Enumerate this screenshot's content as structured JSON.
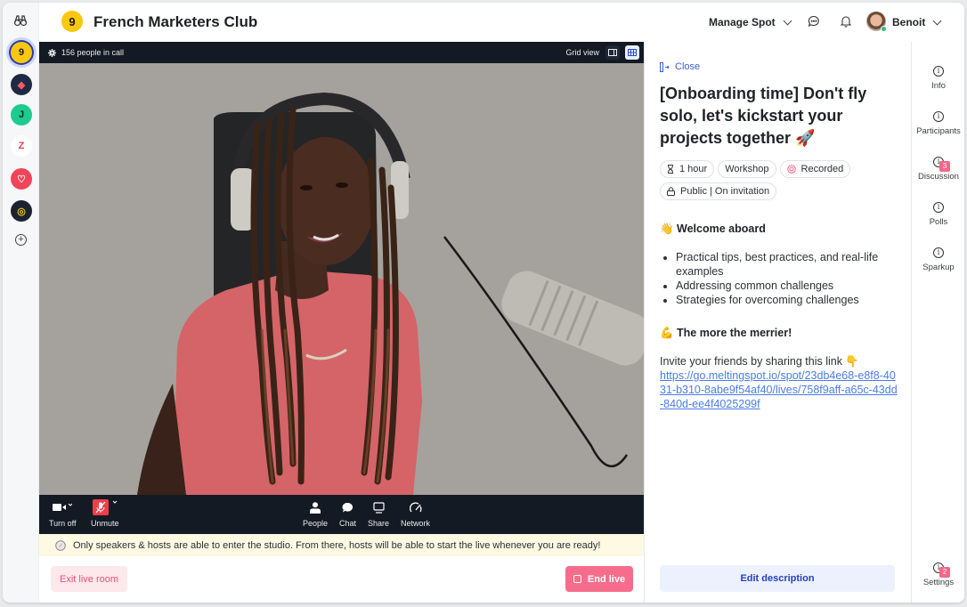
{
  "app": {
    "club_name": "French Marketers Club",
    "logo_glyph": "9"
  },
  "rail": {
    "top_icon": "binoculars-icon",
    "spots": [
      {
        "name": "french-marketers-club",
        "glyph": "9",
        "bg": "#f9c80e",
        "fg": "#1a1a1a",
        "active": true
      },
      {
        "name": "spot-2",
        "glyph": "◆",
        "bg": "#1f2a44",
        "fg": "#ff5a5f",
        "active": false
      },
      {
        "name": "spot-3",
        "glyph": "J",
        "bg": "#1ecb8c",
        "fg": "#0e2a33",
        "active": false
      },
      {
        "name": "spot-4",
        "glyph": "Z",
        "bg": "#ffffff",
        "fg": "#ee3b4a",
        "active": false
      },
      {
        "name": "spot-5",
        "glyph": "♡",
        "bg": "#f0445b",
        "fg": "#ffffff",
        "active": false
      },
      {
        "name": "spot-6",
        "glyph": "◎",
        "bg": "#1b2230",
        "fg": "#f1c40f",
        "active": false
      }
    ],
    "add_label": "+"
  },
  "header": {
    "manage_label": "Manage Spot",
    "user_name": "Benoit",
    "icons": [
      "chat-icon",
      "bell-icon"
    ]
  },
  "video": {
    "people_count": "156 people in call",
    "view_label": "Grid view",
    "controls_left": [
      {
        "label": "Turn off",
        "icon": "camera-icon"
      },
      {
        "label": "Unmute",
        "icon": "mic-muted-icon"
      }
    ],
    "controls_center": [
      {
        "label": "People",
        "icon": "person-icon"
      },
      {
        "label": "Chat",
        "icon": "chat-bubble-icon"
      },
      {
        "label": "Share",
        "icon": "screen-share-icon"
      },
      {
        "label": "Network",
        "icon": "gauge-icon"
      }
    ]
  },
  "notice": {
    "text": "Only speakers & hosts are able to enter the studio. From there, hosts will be able to start the live whenever you are ready!"
  },
  "actions": {
    "exit_label": "Exit live room",
    "end_label": "End live"
  },
  "panel": {
    "close_label": "Close",
    "title": "[Onboarding time] Don't fly solo, let's kickstart your projects together 🚀",
    "chips": [
      {
        "icon": "hourglass-icon",
        "label": "1 hour"
      },
      {
        "icon": "",
        "label": "Workshop"
      },
      {
        "icon": "record-icon",
        "label": "Recorded"
      },
      {
        "icon": "lock-icon",
        "label": "Public | On invitation"
      }
    ],
    "section1_title": "👋 Welcome aboard",
    "bullets": [
      "Practical tips, best practices, and real-life examples",
      "Addressing common challenges",
      "Strategies for overcoming challenges"
    ],
    "section2_title": "💪 The more the merrier!",
    "invite_text": "Invite your friends by sharing this link 👇",
    "invite_link": "https://go.meltingspot.io/spot/23db4e68-e8f8-4031-b310-8abe9f54af40/lives/758f9aff-a65c-43dd-840d-ee4f4025299f",
    "edit_label": "Edit description"
  },
  "tabs": [
    {
      "label": "Info",
      "badge": null
    },
    {
      "label": "Participants",
      "badge": null
    },
    {
      "label": "Discussion",
      "badge": "3"
    },
    {
      "label": "Polls",
      "badge": null
    },
    {
      "label": "Sparkup",
      "badge": null
    },
    {
      "label": "Settings",
      "badge": "2"
    }
  ],
  "colors": {
    "accent_blue": "#3b5bd9",
    "pink": "#f66d8c",
    "notice_bg": "#fdf9e3",
    "dark_bar": "#141a23"
  }
}
